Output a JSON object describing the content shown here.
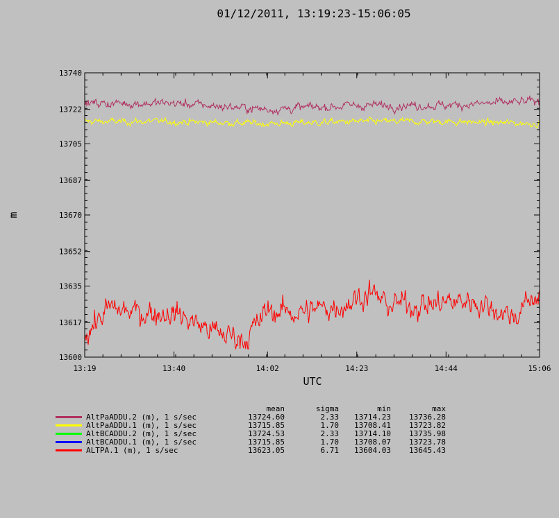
{
  "chart_data": {
    "type": "line",
    "title": "01/12/2011, 13:19:23-15:06:05",
    "xlabel": "UTC",
    "ylabel": "m",
    "ylim": [
      13600,
      13740
    ],
    "xlim": [
      "13:19",
      "15:06"
    ],
    "x_ticks": [
      "13:19",
      "13:40",
      "14:02",
      "14:23",
      "14:44",
      "15:06"
    ],
    "y_ticks": [
      "13600",
      "13617",
      "13635",
      "13652",
      "13670",
      "13687",
      "13705",
      "13722",
      "13740"
    ],
    "grid": false,
    "legend_position": "bottom",
    "stat_headers": [
      "mean",
      "sigma",
      "min",
      "max"
    ],
    "series": [
      {
        "name": "AltPaADDU.2 (m), 1 s/sec",
        "color": "#b03060",
        "mean": "13724.60",
        "sigma": "2.33",
        "min": "13714.23",
        "max": "13736.28",
        "approx_profile_x": [
          "13:19",
          "13:40",
          "14:02",
          "14:23",
          "14:44",
          "15:06"
        ],
        "approx_profile_y": [
          13725,
          13725,
          13722,
          13724,
          13724,
          13726
        ]
      },
      {
        "name": "AltPaADDU.1 (m), 1 s/sec",
        "color": "#ffff00",
        "mean": "13715.85",
        "sigma": "1.70",
        "min": "13708.41",
        "max": "13723.82",
        "approx_profile_x": [
          "13:19",
          "13:40",
          "14:02",
          "14:23",
          "14:44",
          "15:06"
        ],
        "approx_profile_y": [
          13716,
          13716,
          13715,
          13716,
          13716,
          13715
        ]
      },
      {
        "name": "AltBCADDU.2 (m), 1 s/sec",
        "color": "#00ff00",
        "mean": "13724.53",
        "sigma": "2.33",
        "min": "13714.10",
        "max": "13735.98"
      },
      {
        "name": "AltBCADDU.1 (m), 1 s/sec",
        "color": "#0000ff",
        "mean": "13715.85",
        "sigma": "1.70",
        "min": "13708.07",
        "max": "13723.78"
      },
      {
        "name": "ALTPA.1 (m), 1 s/sec",
        "color": "#ff0000",
        "mean": "13623.05",
        "sigma": "6.71",
        "min": "13604.03",
        "max": "13645.43",
        "approx_profile_x": [
          "13:19",
          "13:25",
          "13:30",
          "13:40",
          "13:50",
          "13:57",
          "14:02",
          "14:10",
          "14:20",
          "14:26",
          "14:30",
          "14:40",
          "14:50",
          "15:00",
          "15:06"
        ],
        "approx_profile_y": [
          13612,
          13624,
          13622,
          13622,
          13612,
          13609,
          13623,
          13622,
          13626,
          13632,
          13626,
          13626,
          13628,
          13620,
          13632
        ]
      }
    ]
  }
}
